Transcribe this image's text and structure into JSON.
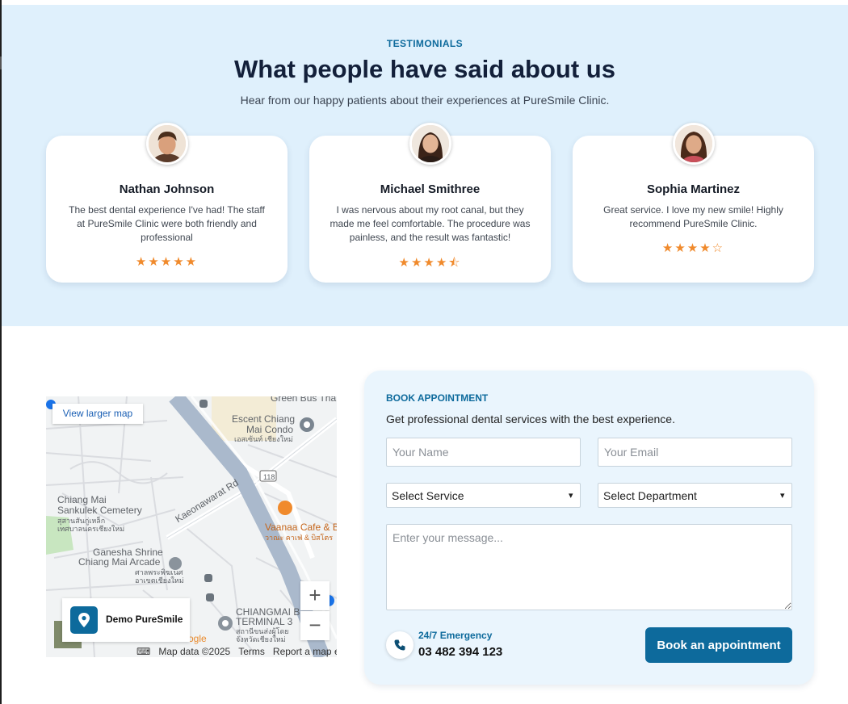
{
  "testimonials": {
    "eyebrow": "TESTIMONIALS",
    "title": "What people have said about us",
    "subtitle": "Hear from our happy patients about their experiences at PureSmile Clinic.",
    "cards": [
      {
        "name": "Nathan Johnson",
        "quote": "The best dental experience I've had! The staff at PureSmile Clinic were both friendly and professional",
        "stars": "★★★★★",
        "rating": 5
      },
      {
        "name": "Michael Smithree",
        "quote": "I was nervous about my root canal, but they made me feel comfortable. The procedure was painless, and the result was fantastic!",
        "stars": "★★★★⯪",
        "rating": 4.5
      },
      {
        "name": "Sophia Martinez",
        "quote": "Great service. I love my new smile! Highly recommend PureSmile Clinic.",
        "stars": "★★★★☆",
        "rating": 4
      }
    ]
  },
  "map": {
    "larger_map": "View larger map",
    "place_name": "Demo PureSmile",
    "zoom_in": "+",
    "zoom_out": "−",
    "footer": {
      "data": "Map data ©2025",
      "terms": "Terms",
      "report": "Report a map error"
    },
    "labels": {
      "green_bus": "Green Bus Tha",
      "escent": "Escent Chiang",
      "mai_condo": "Mai Condo",
      "escent_th": "เอสเซ้นท์ เชียงใหม่",
      "highway": "118",
      "cemetery1": "Chiang Mai",
      "cemetery2": "Sankulek Cemetery",
      "cemetery_th1": "สุสานสันกู่เหล็ก",
      "cemetery_th2": "เทศบาลนครเชียงใหม่",
      "road": "Kaeonawarat Rd",
      "cafe": "Vaanaa Cafe & B",
      "cafe_th": "วาณะ คาเฟ่ & บิสโตร",
      "shrine1": "Ganesha Shrine",
      "shrine2": "Chiang Mai Arcade",
      "shrine_th1": "ศาลพระพิฆเนศ",
      "shrine_th2": "อาเขตเชียงใหม่",
      "terminal1": "CHIANGMAI B",
      "terminal2": "TERMINAL 3",
      "terminal_th1": "สถานีขนส่งผู้โดย",
      "terminal_th2": "จังหวัดเชียงใหม่",
      "google": "ogle"
    }
  },
  "booking": {
    "eyebrow": "BOOK APPOINTMENT",
    "subtitle": "Get professional dental services with the best experience.",
    "name_placeholder": "Your Name",
    "email_placeholder": "Your Email",
    "service_selected": "Select Service",
    "department_selected": "Select Department",
    "message_placeholder": "Enter your message...",
    "emergency_label": "24/7 Emergency",
    "emergency_phone": "03 482 394 123",
    "button": "Book an appointment"
  },
  "colors": {
    "primary": "#0d6a9c",
    "star": "#f08a2c",
    "section_bg": "#dff0fc",
    "booking_bg": "#eaf5fd"
  }
}
